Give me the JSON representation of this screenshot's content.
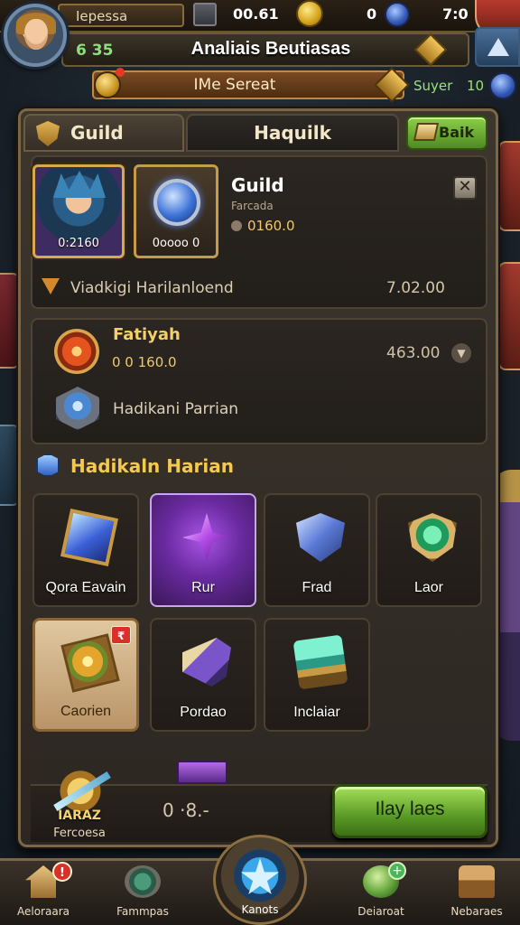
{
  "hud": {
    "player_name": "Iepessa",
    "time": "00.61",
    "gold_count": "0",
    "clock": "7:0"
  },
  "title_bar": {
    "level": "6 35",
    "title": "Analiais Beutiasas"
  },
  "sub_bar": {
    "text": "IMe Sereat",
    "label": "Suyer",
    "count": "10"
  },
  "tabs": {
    "guild_label": "Guild",
    "other_label": "Haquilk",
    "back_label": "Baik"
  },
  "guild_card": {
    "hero_label": "0:2160",
    "orb_label": "0oooo 0",
    "name": "Guild",
    "subtitle": "Farcada",
    "value": "0160.0",
    "close_symbol": "✕",
    "mission_label": "Viadkigi Harilanloend",
    "mission_value": "7.02.00"
  },
  "rewards_card": {
    "row1_name": "Fatiyah",
    "row1_value": "0 0 160.0",
    "row1_amount": "463.00",
    "row2_name": "Hadikani Parrian"
  },
  "section": {
    "title": "Hadikaln Harian"
  },
  "items": [
    {
      "name": "Qora Eavain",
      "icon": "blue-crystal-icon"
    },
    {
      "name": "Rur",
      "icon": "purple-dagger-icon"
    },
    {
      "name": "Frad",
      "icon": "sword-shield-icon"
    },
    {
      "name": "Laor",
      "icon": "green-shield-icon"
    },
    {
      "name": "Caorien",
      "icon": "amber-gem-icon",
      "badge": "₹"
    },
    {
      "name": "Pordao",
      "icon": "horn-icon"
    },
    {
      "name": "Inclaiar",
      "icon": "chest-icon"
    }
  ],
  "bottom": {
    "reward_title": "IARAZ",
    "reward_sub": "Fercoesa",
    "amount": "0 ·8.-",
    "play_label": "Ilay laes"
  },
  "nav": {
    "item1": "Aeloraara",
    "item2": "Fammpas",
    "center": "Kanots",
    "item4": "Deiaroat",
    "item5": "Nebaraes",
    "badge1": "!"
  },
  "colors": {
    "accent_gold": "#f3c94f",
    "play_green": "#5a9a26",
    "panel_border": "#7b6748",
    "alert_red": "#d8312a"
  }
}
